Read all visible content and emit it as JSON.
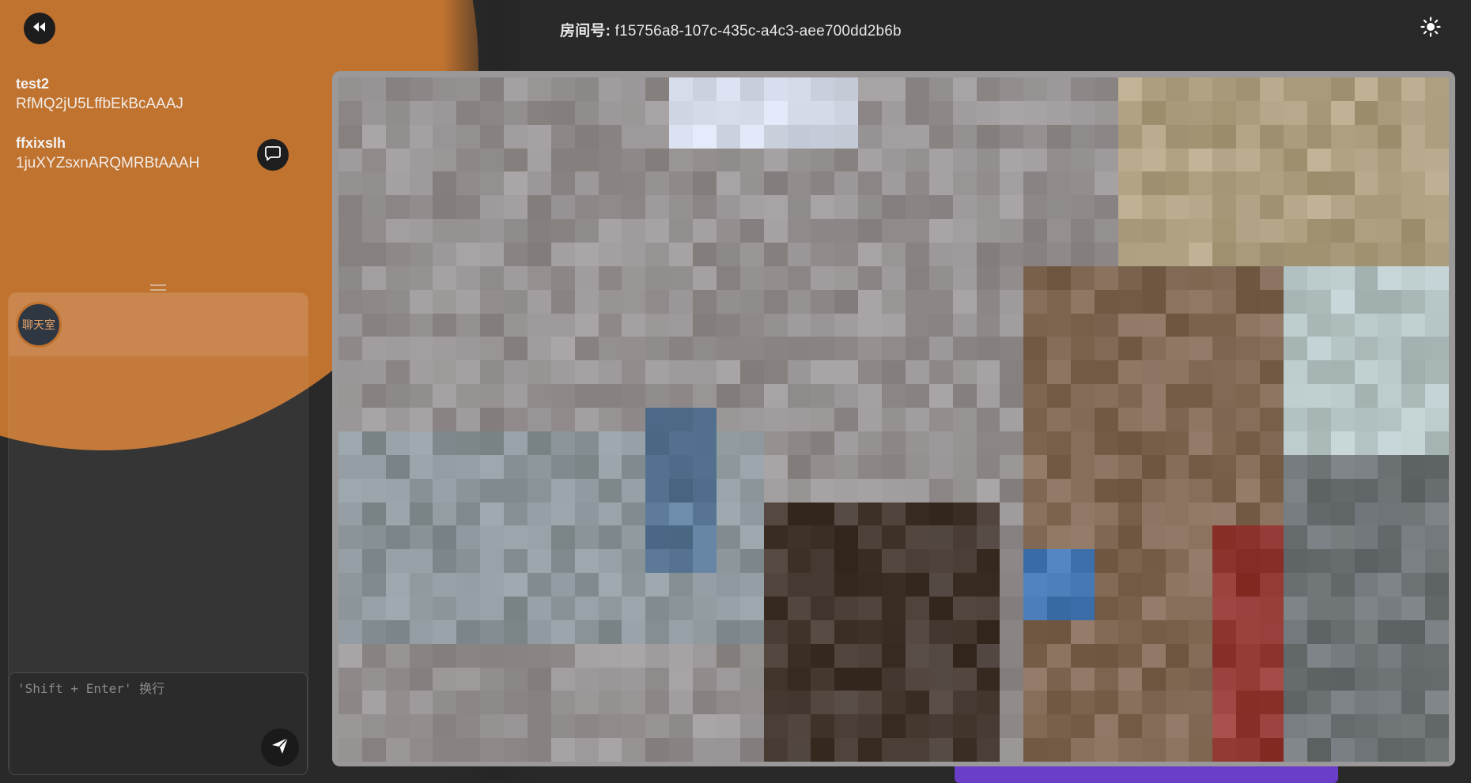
{
  "header": {
    "room_label": "房间号:",
    "room_id": "f15756a8-107c-435c-a4c3-aee700dd2b6b"
  },
  "icons": {
    "back": "rewind-icon",
    "theme": "sun-icon",
    "message": "chat-bubble-icon",
    "send": "paper-plane-icon"
  },
  "users": [
    {
      "name": "test2",
      "id": "RfMQ2jU5LffbEkBcAAAJ"
    },
    {
      "name": "ffxixslh",
      "id": "1juXYZsxnARQMRBtAAAH"
    }
  ],
  "chat": {
    "room_avatar_label": "聊天室",
    "input_placeholder": "'Shift + Enter' 换行"
  },
  "colors": {
    "accent": "#c0722f",
    "background": "#292929",
    "video_bar": "#6a3ec9"
  }
}
